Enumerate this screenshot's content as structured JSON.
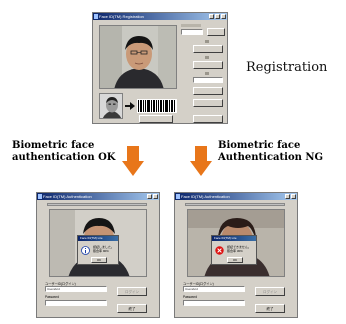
{
  "registration": {
    "caption": "Registration",
    "window_title": "Face ID(TM) Registration"
  },
  "auth_ok": {
    "caption_line1": "Biometric face",
    "caption_line2": "authentication OK",
    "window_title": "Face ID(TM) Authentication",
    "dialog_title": "Face ID(TM) Lite",
    "dialog_line1": "認証しました。",
    "dialog_line2": "照合率 90%",
    "dialog_ok": "OK",
    "user_label": "ユーザーID(ログイン)",
    "user_value": "Userabcd",
    "pw_label": "Password",
    "login_button": "ログイン",
    "close_button": "終了"
  },
  "auth_ng": {
    "caption_line1": "Biometric face",
    "caption_line2": "Authentication NG",
    "window_title": "Face ID(TM) Authentication",
    "dialog_title": "Face ID(TM) Lite",
    "dialog_line1": "認証できません。",
    "dialog_line2": "照合率 30%",
    "dialog_ok": "OK",
    "user_label": "ユーザーID(ログイン)",
    "user_value": "Userabcd",
    "pw_label": "Password",
    "login_button": "ログイン",
    "close_button": "終了"
  },
  "colors": {
    "arrow": "#e8761a",
    "window": "#d4d0c8",
    "titlebar": "#0a246a"
  }
}
